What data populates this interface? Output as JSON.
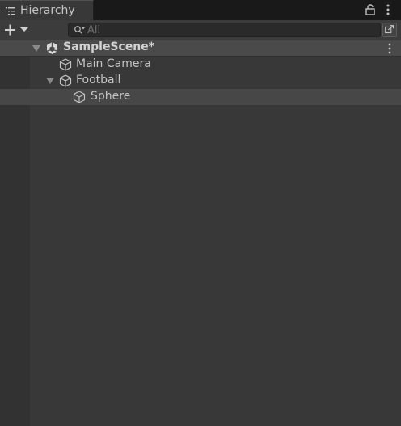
{
  "window": {
    "tab_title": "Hierarchy",
    "icons": {
      "tab": "list-icon",
      "lock": "lock-icon",
      "menu": "kebab-menu-icon"
    }
  },
  "toolbar": {
    "add_icon": "plus-dropdown-icon",
    "search": {
      "placeholder": "All",
      "value": ""
    },
    "filter_icon": "scene-visibility-icon"
  },
  "hierarchy": {
    "scene": {
      "name": "SampleScene*",
      "expanded": true
    },
    "items": [
      {
        "name": "Main Camera",
        "depth": 1,
        "expanded": null,
        "selected": false
      },
      {
        "name": "Football",
        "depth": 1,
        "expanded": true,
        "selected": false
      },
      {
        "name": "Sphere",
        "depth": 2,
        "expanded": null,
        "selected": true
      }
    ]
  },
  "colors": {
    "background": "#383838",
    "tabbar": "#191919",
    "scene_row": "#4a4a4a",
    "selection": "#474747",
    "text": "#c4c4c4"
  }
}
